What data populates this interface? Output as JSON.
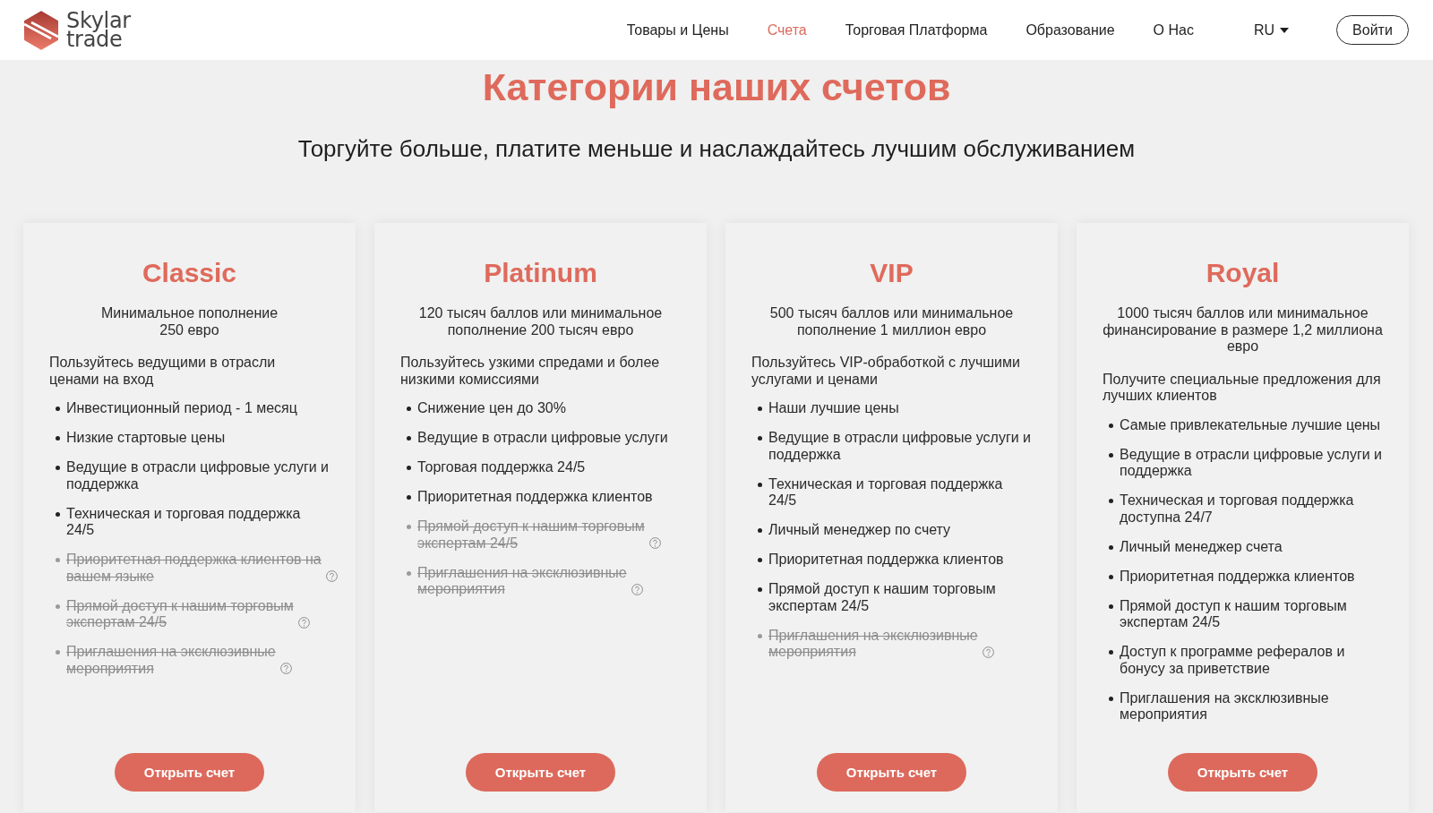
{
  "header": {
    "logo": {
      "lines": [
        "Skylar",
        "trade"
      ]
    },
    "nav": [
      {
        "label": "Товары и Цены",
        "selected": false
      },
      {
        "label": "Счета",
        "selected": true
      },
      {
        "label": "Торговая Платформа",
        "selected": false
      },
      {
        "label": "Образование",
        "selected": false
      },
      {
        "label": "О Нас",
        "selected": false
      }
    ],
    "language": {
      "label": "RU"
    },
    "login_button": {
      "label": "Войти"
    }
  },
  "heading": {
    "title": "Категории наших счетов",
    "subtitle": "Торгуйте больше, платите меньше и наслаждайтесь лучшим обслуживанием"
  },
  "plans": [
    {
      "name": "Classic",
      "deposit": "Минимальное пополнение\n250 евро",
      "description": "Пользуйтесь ведущими в отрасли\nценами на вход",
      "features": [
        {
          "text": "Инвестиционный период - 1 месяц",
          "included": true
        },
        {
          "text": "Низкие стартовые цены",
          "included": true
        },
        {
          "text": "Ведущие в отрасли цифровые услуги и\nподдержка",
          "included": true
        },
        {
          "text": "Техническая и торговая поддержка\n24/5",
          "included": true
        },
        {
          "text": "Приоритетная поддержка клиентов на\nвашем языке",
          "included": false
        },
        {
          "text": "Прямой доступ к нашим торговым\nэкспертам 24/5",
          "included": false
        },
        {
          "text": "Приглашения на эксклюзивные\nмероприятия",
          "included": false
        }
      ],
      "button": "Открыть счет"
    },
    {
      "name": "Platinum",
      "deposit": "120 тысяч баллов или минимальное\nпополнение 200 тысяч евро",
      "description": "Пользуйтесь узкими спредами и более\nнизкими комиссиями",
      "features": [
        {
          "text": "Снижение цен до 30%",
          "included": true
        },
        {
          "text": "Ведущие в отрасли цифровые услуги",
          "included": true
        },
        {
          "text": "Торговая поддержка 24/5",
          "included": true
        },
        {
          "text": "Приоритетная поддержка клиентов",
          "included": true
        },
        {
          "text": "Прямой доступ к нашим торговым\nэкспертам 24/5",
          "included": false
        },
        {
          "text": "Приглашения на эксклюзивные\nмероприятия",
          "included": false
        }
      ],
      "button": "Открыть счет"
    },
    {
      "name": "VIP",
      "deposit": "500 тысяч баллов или минимальное\nпополнение 1 миллион евро",
      "description": "Пользуйтесь VIP-обработкой с лучшими\nуслугами и ценами",
      "features": [
        {
          "text": "Наши лучшие цены",
          "included": true
        },
        {
          "text": "Ведущие в отрасли цифровые услуги и\nподдержка",
          "included": true
        },
        {
          "text": "Техническая и торговая поддержка\n24/5",
          "included": true
        },
        {
          "text": "Личный менеджер по счету",
          "included": true
        },
        {
          "text": "Приоритетная поддержка клиентов",
          "included": true
        },
        {
          "text": "Прямой доступ к нашим торговым\nэкспертам 24/5",
          "included": true
        },
        {
          "text": "Приглашения на эксклюзивные\nмероприятия",
          "included": false
        }
      ],
      "button": "Открыть счет"
    },
    {
      "name": "Royal",
      "deposit": "1000 тысяч баллов или минимальное\nфинансирование в размере 1,2 миллиона\nевро",
      "description": "Получите специальные предложения для\nлучших клиентов",
      "features": [
        {
          "text": "Самые привлекательные лучшие цены",
          "included": true
        },
        {
          "text": "Ведущие в отрасли цифровые услуги и\nподдержка",
          "included": true
        },
        {
          "text": "Техническая и торговая поддержка\nдоступна 24/7",
          "included": true
        },
        {
          "text": "Личный менеджер счета",
          "included": true
        },
        {
          "text": "Приоритетная поддержка клиентов",
          "included": true
        },
        {
          "text": "Прямой доступ к нашим торговым\nэкспертам 24/5",
          "included": true
        },
        {
          "text": "Доступ к программе рефералов и\nбонусу за приветствие",
          "included": true
        },
        {
          "text": "Приглашения на эксклюзивные\nмероприятия",
          "included": true
        }
      ],
      "button": "Открыть счет"
    }
  ]
}
